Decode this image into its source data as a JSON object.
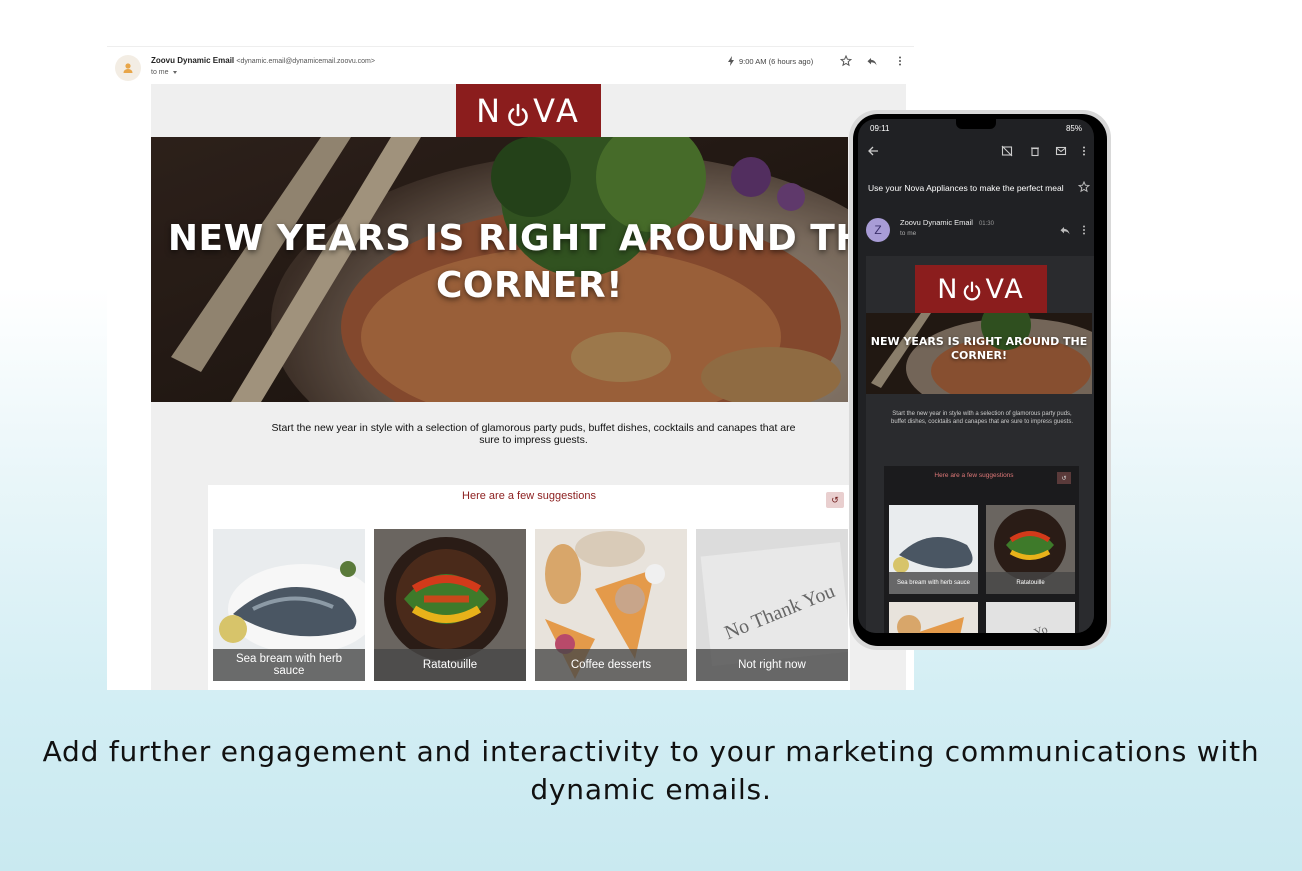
{
  "email": {
    "sender_name": "Zoovu Dynamic Email",
    "sender_address": "<dynamic.email@dynamicemail.zoovu.com>",
    "recipient": "to me",
    "timestamp": "9:00 AM (6 hours ago)",
    "brand": {
      "logo_text_left": "N",
      "logo_text_right": "VA",
      "color": "#8b1d1d"
    },
    "hero_title": "NEW YEARS IS RIGHT AROUND THE CORNER!",
    "intro_text": "Start the new year in style with a selection of glamorous party puds, buffet dishes, cocktails and canapes that are sure to impress guests.",
    "suggestions_title": "Here are a few suggestions",
    "refresh_icon": "↺",
    "cards": [
      {
        "label": "Sea bream with herb sauce"
      },
      {
        "label": "Ratatouille"
      },
      {
        "label": "Coffee desserts"
      },
      {
        "label": "Not right now"
      }
    ],
    "card4_image_text": "No Thank You"
  },
  "phone": {
    "status_time": "09:11",
    "status_battery": "85%",
    "subject": "Use your Nova Appliances to make the perfect meal",
    "avatar_letter": "Z",
    "sender_name": "Zoovu Dynamic Email",
    "time": "01:30",
    "recipient": "to me",
    "hero_title": "NEW YEARS IS RIGHT AROUND THE CORNER!",
    "intro_text": "Start the new year in style with a selection of glamorous party puds, buffet dishes, cocktails and canapes that are sure to impress guests.",
    "suggestions_title": "Here are a few suggestions",
    "refresh_icon": "↺",
    "cards": [
      {
        "label": "Sea bream with herb sauce"
      },
      {
        "label": "Ratatouille"
      },
      {
        "label": ""
      },
      {
        "label": ""
      }
    ],
    "card4_image_text": "Yo"
  },
  "caption": "Add further engagement and interactivity to your marketing communications with dynamic emails.",
  "icons": [
    "person-avatar-icon",
    "bolt-icon",
    "star-icon",
    "reply-icon",
    "more-vert-icon",
    "back-arrow-icon",
    "archive-icon",
    "trash-icon",
    "mail-icon",
    "refresh-icon",
    "power-icon"
  ]
}
